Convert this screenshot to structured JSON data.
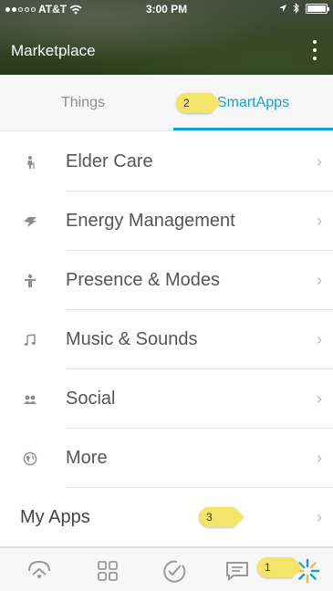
{
  "status_bar": {
    "carrier": "AT&T",
    "time": "3:00 PM"
  },
  "header": {
    "title": "Marketplace"
  },
  "tabs": [
    {
      "label": "Things",
      "active": false
    },
    {
      "label": "SmartApps",
      "active": true
    }
  ],
  "callouts": [
    "2",
    "3",
    "1"
  ],
  "categories": [
    {
      "label": "Elder Care",
      "icon": "elder-care-icon"
    },
    {
      "label": "Energy Management",
      "icon": "energy-icon"
    },
    {
      "label": "Presence & Modes",
      "icon": "presence-icon"
    },
    {
      "label": "Music & Sounds",
      "icon": "music-note-icon"
    },
    {
      "label": "Social",
      "icon": "social-icon"
    },
    {
      "label": "More",
      "icon": "globe-icon"
    }
  ],
  "my_apps": {
    "label": "My Apps"
  },
  "tabbar": [
    "home-icon",
    "grid-icon",
    "check-icon",
    "message-icon",
    "marketplace-icon"
  ],
  "colors": {
    "accent": "#15a0d3",
    "callout": "#f5e46a",
    "text": "#555555"
  }
}
